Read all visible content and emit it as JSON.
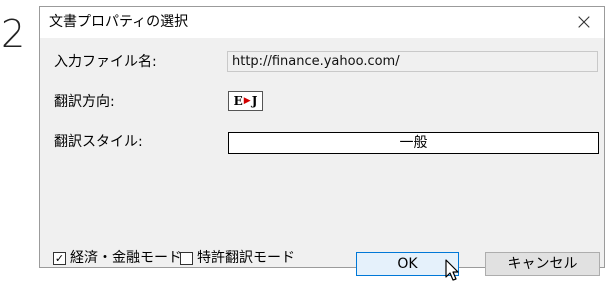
{
  "step_number": "2",
  "dialog": {
    "title": "文書プロパティの選択",
    "close_glyph": "×",
    "input_file_label": "入力ファイル名:",
    "input_file_value": "http://finance.yahoo.com/",
    "direction_label": "翻訳方向:",
    "direction_badge": {
      "from": "E",
      "to": "J",
      "arrow_color": "#d10000"
    },
    "style_label": "翻訳スタイル:",
    "style_value": "一般",
    "checkboxes": [
      {
        "label": "経済・金融モード",
        "checked": true
      },
      {
        "label": "特許翻訳モード",
        "checked": false
      }
    ],
    "ok_label": "OK",
    "cancel_label": "キャンセル"
  },
  "colors": {
    "accent": "#0078d7",
    "dialog_bg": "#f0f0f0"
  },
  "icons": {
    "cursor": "mouse-pointer-icon",
    "close": "close-icon"
  }
}
